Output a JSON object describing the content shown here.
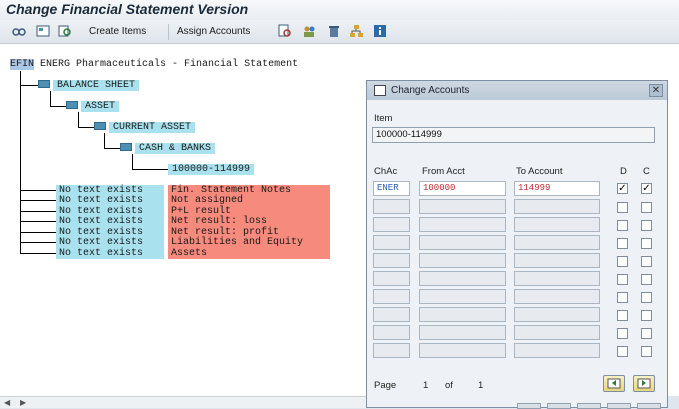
{
  "window": {
    "title": "Change Financial Statement Version"
  },
  "toolbar": {
    "icons": [
      "glasses-icon",
      "layout-icon",
      "search-icon"
    ],
    "create_items": "Create Items",
    "assign_accounts": "Assign Accounts",
    "right_icons": [
      "find-icon",
      "people-icon",
      "delete-icon",
      "hierarchy-icon",
      "info-icon"
    ]
  },
  "tree": {
    "root_code": "EFIN",
    "root_desc": "ENERG Pharmaceuticals - Financial Statement",
    "balance_sheet": "BALANCE SHEET",
    "asset": "ASSET",
    "current_asset": "CURRENT ASSET",
    "cash_banks": "CASH & BANKS",
    "account_range": "100000-114999",
    "no_text": [
      {
        "left": "No text exists",
        "right": "Fin. Statement Notes"
      },
      {
        "left": "No text exists",
        "right": "Not assigned"
      },
      {
        "left": "No text exists",
        "right": "P+L result"
      },
      {
        "left": "No text exists",
        "right": "Net result: loss"
      },
      {
        "left": "No text exists",
        "right": "Net result: profit"
      },
      {
        "left": "No text exists",
        "right": "Liabilities and Equity"
      },
      {
        "left": "No text exists",
        "right": "Assets"
      }
    ]
  },
  "dialog": {
    "title": "Change Accounts",
    "item_label": "Item",
    "item_value": "100000-114999",
    "columns": {
      "chac": "ChAc",
      "from": "From Acct",
      "to": "To Account",
      "d": "D",
      "c": "C"
    },
    "first_row": {
      "chac": "ENER",
      "from": "100000",
      "to": "114999",
      "d": "✓",
      "c": "✓"
    },
    "page_label": "Page",
    "page_current": "1",
    "page_of": "of",
    "page_total": "1"
  },
  "colors": {
    "cyan": "#a9e2ee",
    "red": "#f58a7d",
    "account_text": "#c0282d",
    "chac_text": "#2c5fb0"
  }
}
